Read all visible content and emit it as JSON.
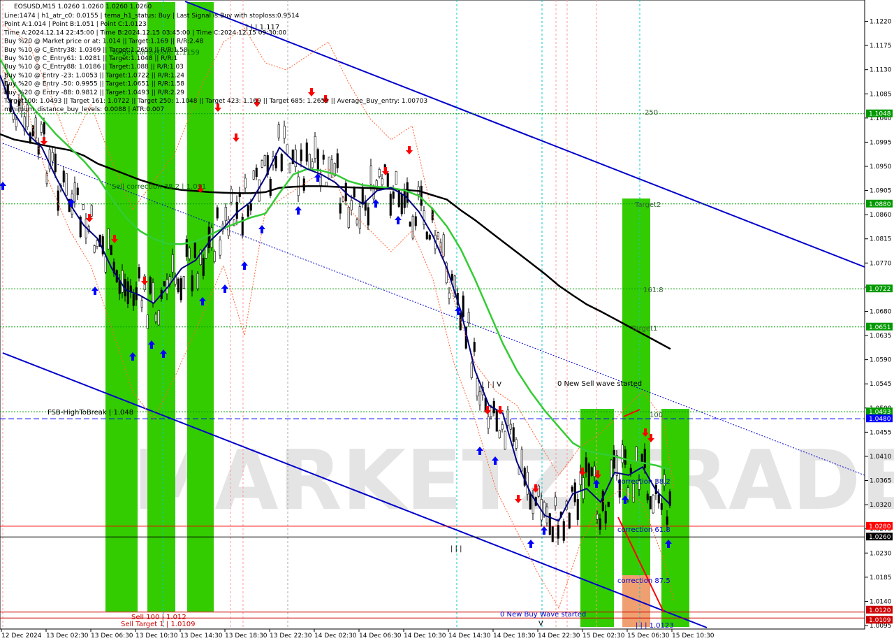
{
  "window": {
    "title": "EOSUSD,M15  1.0260 1.0260 1.0260 1.0260"
  },
  "info_lines": [
    "Line:1474 | h1_atr_c0: 0.0155 | tema_h1_status: Buy | Last Signal is:Buy with stoploss:0.9514",
    "Point A:1.014 | Point B:1.051 | Point C:1.0123",
    "Time A:2024.12.14 22:45:00 | Time B:2024.12.15 03:45:00 | Time C:2024.12.15 09:30:00",
    "Buy %20 @ Market price or at: 1.014 || Target:1.169 || R/R:2.48",
    "Buy %10 @ C_Entry38: 1.0369 || Target:1.2659 || R/R:1.58",
    "Buy %10 @ C_Entry61: 1.0281 || Target:1.1048 || R/R:1",
    "Buy %10 @ C_Entry88: 1.0186 || Target:1.088 || R/R:1.03",
    "Buy %10 @ Entry -23: 1.0053 || Target:1.0722 || R/R:1.24",
    "Buy %20 @ Entry -50: 0.9955 || Target:1.0651 || R/R:1.58",
    "Buy %20 @ Entry -88: 0.9812 || Target:1.0493 || R/R:2.29",
    "Target100: 1.0493 || Target 161: 1.0722 || Target 250: 1.1048 || Target 423: 1.169 || Target 685: 1.2659 || Average_Buy_entry: 1.00703",
    "minimum_distance_buy_levels: 0.0088 | ATR:0.007"
  ],
  "annotations": {
    "top_level": "| | | 1.117",
    "target_correction": "Target correction: 1.1159",
    "sell_correction": "Sell correction 38.2 | 1.091",
    "fsb": "FSB-HighToBreak | 1.048",
    "sell_100": "Sell 100 | 1.012",
    "sell_target": "Sell Target 1 | 1.0109",
    "new_sell_wave": "0 New Sell wave started",
    "new_buy_wave": "0 New Buy Wave started",
    "bottom_level": "| | | 1.0123",
    "v_mark": "V",
    "iii_left": "| | |",
    "iii_mid": "| | V",
    "label_250": "250",
    "label_target2": "Target2",
    "label_1618": "161.8",
    "label_target1": "Target1",
    "label_100": "100",
    "correction_382": "correction 38.2",
    "correction_618": "correction 61.8",
    "correction_875": "correction 87.5"
  },
  "watermark": "MARKETZITRADE",
  "colors": {
    "up_arrow": "#0000ff",
    "down_arrow": "#ff0000",
    "green_zone": "#33cc00",
    "channel": "#0000cc",
    "ma_black": "#000000",
    "ma_green": "#33cc33",
    "tema_navy": "#000080",
    "level_green": "#009900",
    "level_red": "#ff0000",
    "level_blue_dash": "#0000ff"
  },
  "chart_data": {
    "type": "line",
    "symbol": "EOSUSD",
    "timeframe": "M15",
    "ylim": [
      1.0095,
      1.1235
    ],
    "y_ticks": [
      "1.1220",
      "1.1175",
      "1.1130",
      "1.1085",
      "1.1040",
      "1.0995",
      "1.0950",
      "1.0905",
      "1.0860",
      "1.0815",
      "1.0770",
      "1.0725",
      "1.0680",
      "1.0635",
      "1.0590",
      "1.0545",
      "1.0500",
      "1.0455",
      "1.0410",
      "1.0365",
      "1.0320",
      "1.0275",
      "1.0230",
      "1.0185",
      "1.0140",
      "1.0095"
    ],
    "x_ticks": [
      "12 Dec 2024",
      "13 Dec 02:30",
      "13 Dec 06:30",
      "13 Dec 10:30",
      "13 Dec 14:30",
      "13 Dec 18:30",
      "13 Dec 22:30",
      "14 Dec 02:30",
      "14 Dec 06:30",
      "14 Dec 10:30",
      "14 Dec 14:30",
      "14 Dec 18:30",
      "14 Dec 22:30",
      "15 Dec 02:30",
      "15 Dec 06:30",
      "15 Dec 10:30"
    ],
    "levels": [
      {
        "value": "1.1048",
        "color": "#009900"
      },
      {
        "value": "1.0880",
        "color": "#009900"
      },
      {
        "value": "1.0722",
        "color": "#009900"
      },
      {
        "value": "1.0651",
        "color": "#009900"
      },
      {
        "value": "1.0493",
        "color": "#009900"
      },
      {
        "value": "1.0480",
        "color": "#0000ff"
      },
      {
        "value": "1.0280",
        "color": "#ff0000"
      },
      {
        "value": "1.0260",
        "color": "#000000"
      },
      {
        "value": "1.0120",
        "color": "#cc0000"
      },
      {
        "value": "1.0109",
        "color": "#cc0000"
      }
    ],
    "series": [
      {
        "name": "",
        "color": "#000000",
        "x": [
          0,
          20,
          40,
          60,
          80,
          100,
          120,
          140,
          160,
          180,
          200,
          220,
          240,
          260,
          280,
          300,
          320,
          340,
          360,
          380,
          400,
          420,
          440,
          460,
          480,
          500,
          520,
          540,
          560,
          580,
          600,
          620,
          640,
          660,
          680,
          700,
          720,
          740,
          760,
          780,
          800,
          820,
          840,
          860,
          880,
          900,
          920,
          940,
          960
        ],
        "y": [
          1.101,
          1.1,
          1.0995,
          1.099,
          1.0985,
          1.098,
          1.097,
          1.0955,
          1.0945,
          1.0935,
          1.0925,
          1.0917,
          1.091,
          1.0906,
          1.0904,
          1.0902,
          1.0901,
          1.09,
          1.09,
          1.0902,
          1.091,
          1.0912,
          1.0913,
          1.0913,
          1.0912,
          1.0911,
          1.091,
          1.0909,
          1.0908,
          1.0906,
          1.0904,
          1.0896,
          1.0888,
          1.0868,
          1.085,
          1.083,
          1.081,
          1.079,
          1.077,
          1.075,
          1.0728,
          1.071,
          1.0693,
          1.068,
          1.0666,
          1.0652,
          1.0638,
          1.0624,
          1.061
        ]
      },
      {
        "name": "",
        "color": "#33cc33",
        "x": [
          0,
          20,
          40,
          60,
          80,
          100,
          120,
          140,
          160,
          180,
          200,
          220,
          240,
          260,
          280,
          300,
          320,
          340,
          360,
          380,
          400,
          420,
          440,
          460,
          480,
          500,
          520,
          540,
          560,
          580,
          600,
          620,
          640,
          660,
          680,
          700,
          720,
          740,
          760,
          780,
          800,
          820,
          840,
          860,
          880,
          900,
          920,
          940,
          960
        ],
        "y": [
          1.115,
          1.1105,
          1.107,
          1.104,
          1.101,
          1.0985,
          1.096,
          1.093,
          1.089,
          1.0855,
          1.083,
          1.0815,
          1.0806,
          1.0805,
          1.081,
          1.0822,
          1.0835,
          1.0845,
          1.0855,
          1.0862,
          1.09,
          1.0935,
          1.0945,
          1.0942,
          1.0935,
          1.0922,
          1.0915,
          1.0912,
          1.091,
          1.0905,
          1.0895,
          1.087,
          1.0838,
          1.0795,
          1.074,
          1.068,
          1.062,
          1.057,
          1.053,
          1.0495,
          1.0465,
          1.0435,
          1.042,
          1.0415,
          1.041,
          1.0403,
          1.0398,
          1.0393,
          1.0385
        ]
      },
      {
        "name": "",
        "color": "#000080",
        "x": [
          0,
          20,
          40,
          60,
          80,
          100,
          120,
          140,
          160,
          180,
          200,
          220,
          240,
          260,
          280,
          300,
          320,
          340,
          360,
          380,
          400,
          420,
          440,
          460,
          480,
          500,
          520,
          540,
          560,
          580,
          600,
          620,
          640,
          660,
          680,
          700,
          720,
          740,
          760,
          780,
          800,
          820,
          840,
          860,
          880,
          900,
          920,
          940,
          960
        ],
        "y": [
          1.112,
          1.105,
          1.101,
          1.0985,
          1.093,
          1.088,
          1.084,
          1.0815,
          1.076,
          1.072,
          1.071,
          1.0695,
          1.0725,
          1.076,
          1.0775,
          1.081,
          1.0835,
          1.0865,
          1.0885,
          1.093,
          1.0985,
          1.096,
          1.0945,
          1.0935,
          1.092,
          1.0895,
          1.088,
          1.0905,
          1.091,
          1.0895,
          1.0865,
          1.082,
          1.076,
          1.068,
          1.057,
          1.0505,
          1.049,
          1.04,
          1.034,
          1.03,
          1.029,
          1.034,
          1.035,
          1.0325,
          1.038,
          1.0375,
          1.039,
          1.0345,
          1.032
        ]
      }
    ]
  }
}
